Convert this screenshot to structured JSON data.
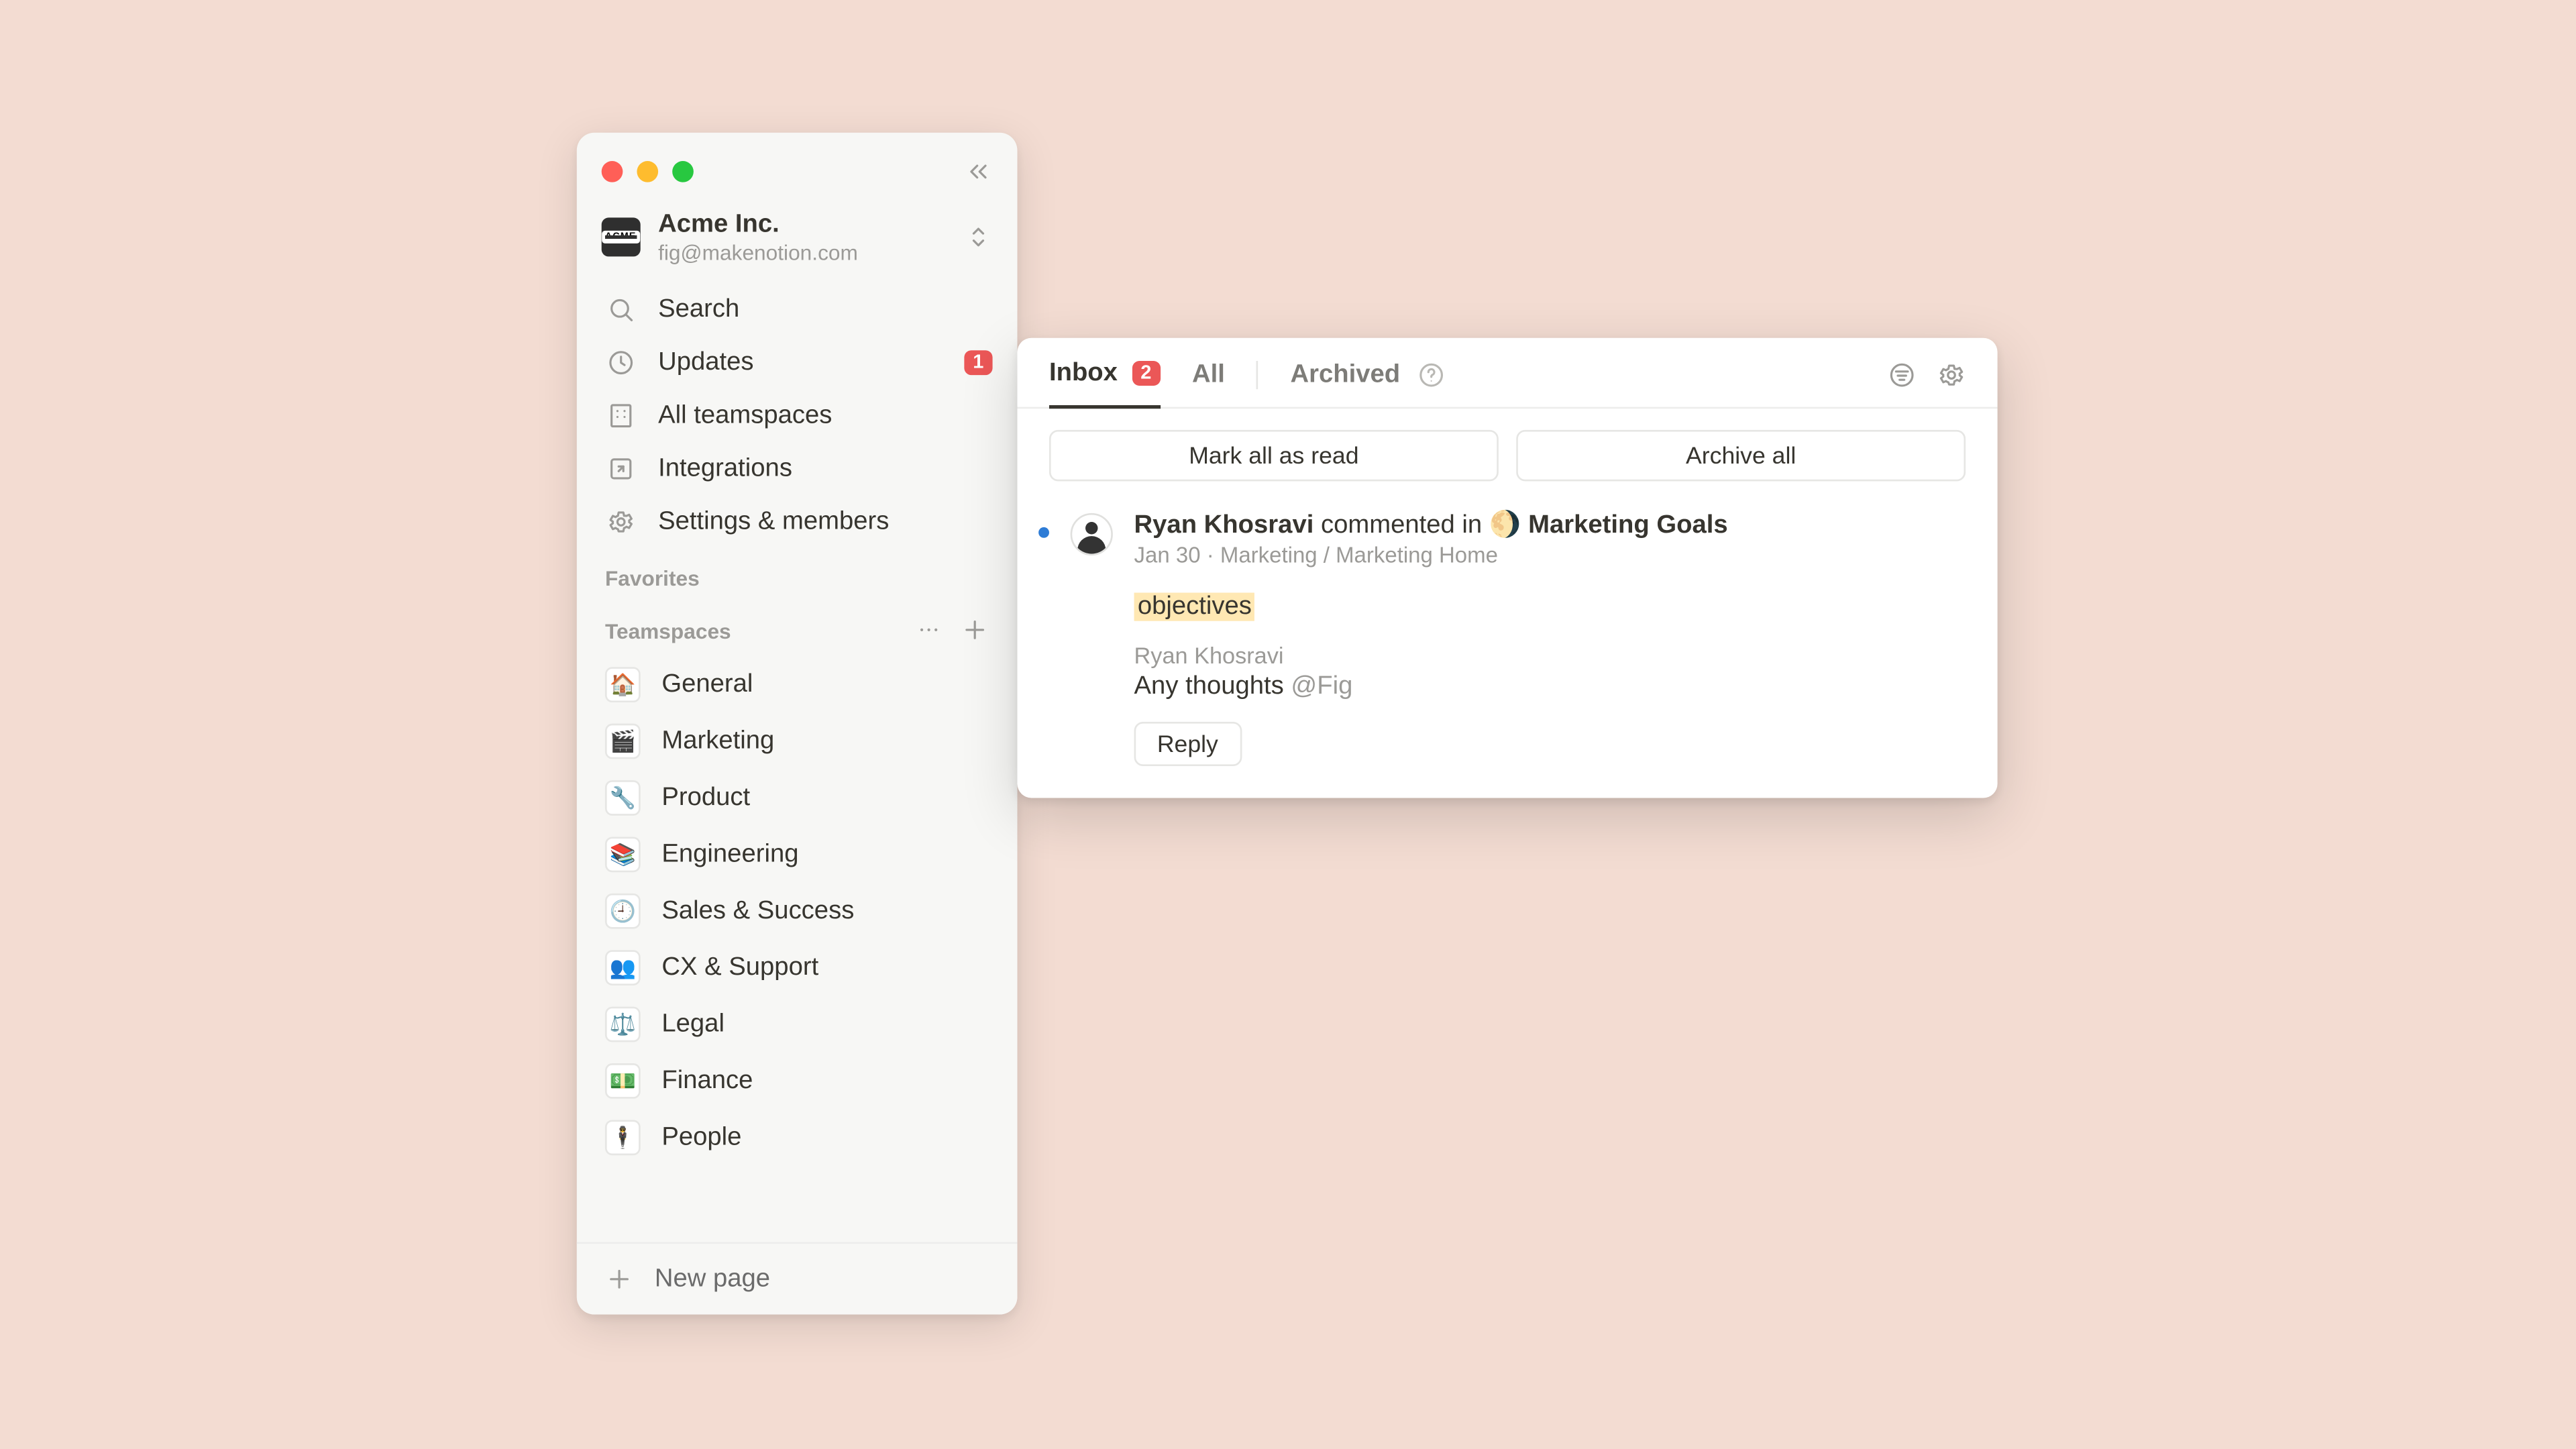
{
  "workspace": {
    "logo_text": "ACME",
    "name": "Acme Inc.",
    "email": "fig@makenotion.com"
  },
  "nav": {
    "search": "Search",
    "updates": "Updates",
    "updates_badge": "1",
    "all_teamspaces": "All teamspaces",
    "integrations": "Integrations",
    "settings": "Settings & members"
  },
  "sections": {
    "favorites": "Favorites",
    "teamspaces": "Teamspaces"
  },
  "teamspaces": [
    {
      "icon": "🏠",
      "label": "General"
    },
    {
      "icon": "🎬",
      "label": "Marketing"
    },
    {
      "icon": "🔧",
      "label": "Product"
    },
    {
      "icon": "📚",
      "label": "Engineering"
    },
    {
      "icon": "🕘",
      "label": "Sales & Success"
    },
    {
      "icon": "👥",
      "label": "CX & Support"
    },
    {
      "icon": "⚖️",
      "label": "Legal"
    },
    {
      "icon": "💵",
      "label": "Finance"
    },
    {
      "icon": "🕴️",
      "label": "People"
    }
  ],
  "new_page": "New page",
  "inbox": {
    "tabs": {
      "inbox": "Inbox",
      "inbox_count": "2",
      "all": "All",
      "archived": "Archived"
    },
    "actions": {
      "mark_all": "Mark all as read",
      "archive_all": "Archive all"
    },
    "notification": {
      "author": "Ryan Khosravi",
      "verb": "commented in",
      "page_emoji": "🌖",
      "page_name": "Marketing Goals",
      "date": "Jan 30",
      "breadcrumb": "Marketing / Marketing Home",
      "highlight": "objectives",
      "comment_author": "Ryan Khosravi",
      "comment_text": "Any thoughts ",
      "mention": "@Fig",
      "reply": "Reply"
    }
  }
}
